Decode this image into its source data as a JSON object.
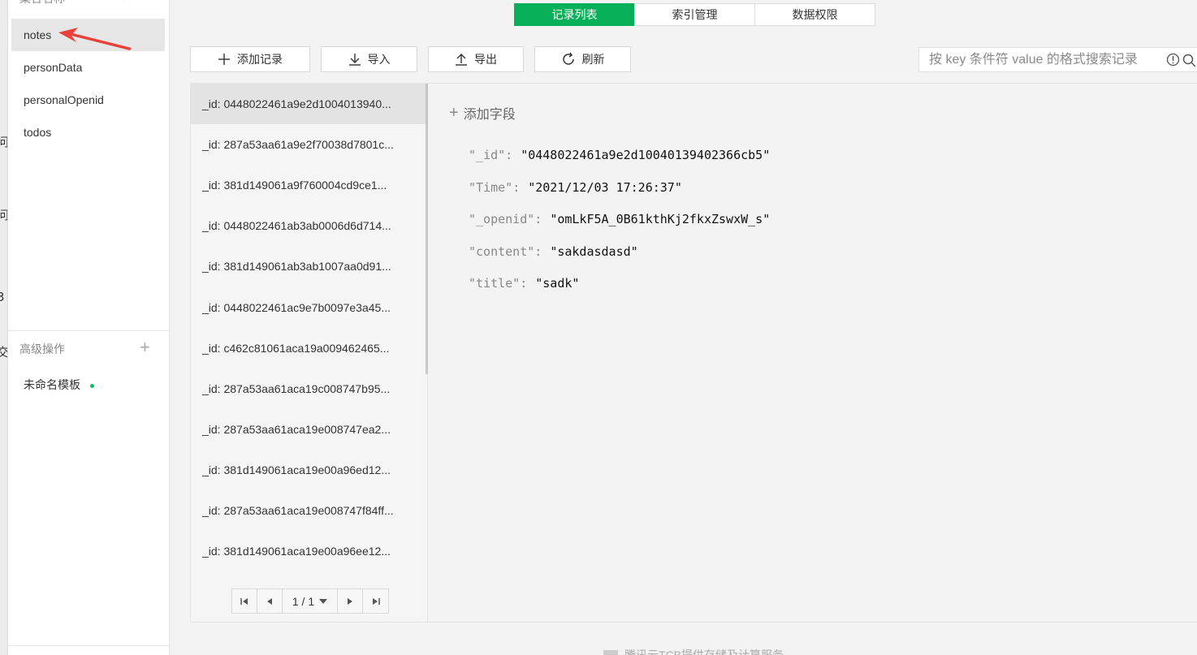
{
  "edge": {
    "chars": [
      "问",
      "问",
      "3",
      "交"
    ]
  },
  "sidebar": {
    "header": "集合名称",
    "items": [
      {
        "label": "notes",
        "active": true
      },
      {
        "label": "personData"
      },
      {
        "label": "personalOpenid"
      },
      {
        "label": "todos"
      }
    ],
    "advanced_label": "高级操作",
    "template_label": "未命名模板"
  },
  "tabs": [
    {
      "label": "记录列表",
      "active": true
    },
    {
      "label": "索引管理"
    },
    {
      "label": "数据权限"
    }
  ],
  "toolbar": {
    "add_label": "添加记录",
    "import_label": "导入",
    "export_label": "导出",
    "refresh_label": "刷新",
    "search_placeholder": "按 key 条件符 value 的格式搜索记录"
  },
  "records": [
    "_id: 0448022461a9e2d1004013940...",
    "_id: 287a53aa61a9e2f70038d7801c...",
    "_id: 381d149061a9f760004cd9ce1...",
    "_id: 0448022461ab3ab0006d6d714...",
    "_id: 381d149061ab3ab1007aa0d91...",
    "_id: 0448022461ac9e7b0097e3a45...",
    "_id: c462c81061aca19a009462465...",
    "_id: 287a53aa61aca19c008747b95...",
    "_id: 287a53aa61aca19e008747ea2...",
    "_id: 381d149061aca19e00a96ed12...",
    "_id: 287a53aa61aca19e008747f84ff...",
    "_id: 381d149061aca19e00a96ee12..."
  ],
  "pager": {
    "page": "1 / 1"
  },
  "detail": {
    "add_field_label": "添加字段",
    "fields": [
      {
        "key": "\"_id\"",
        "value": "\"0448022461a9e2d10040139402366cb5\""
      },
      {
        "key": "\"Time\"",
        "value": "\"2021/12/03 17:26:37\""
      },
      {
        "key": "\"_openid\"",
        "value": "\"omLkF5A_0B61kthKj2fkxZswxW_s\""
      },
      {
        "key": "\"content\"",
        "value": "\"sakdasdasd\""
      },
      {
        "key": "\"title\"",
        "value": "\"sadk\""
      }
    ]
  },
  "footer": {
    "text": "腾讯云TCB提供存储及计算服务"
  },
  "colors": {
    "accent": "#07b058",
    "status_dot": "#07c160",
    "arrow": "#e8413a"
  }
}
